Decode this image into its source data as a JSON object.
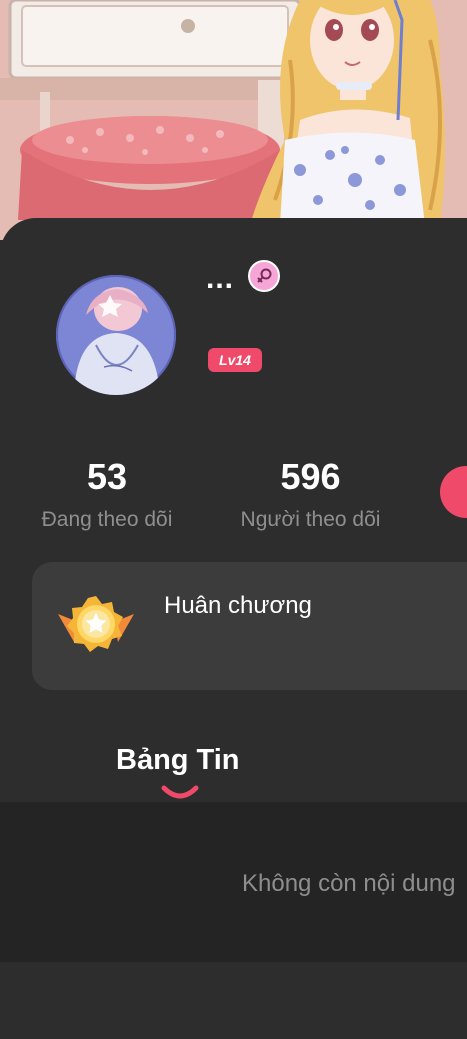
{
  "profile": {
    "username": "...",
    "gender_icon": "female-icon",
    "level": "Lv14",
    "avatar_icon": "avatar-photo"
  },
  "stats": {
    "following_count": "53",
    "following_label": "Đang theo dõi",
    "followers_count": "596",
    "followers_label": "Người theo dõi"
  },
  "medals": {
    "label": "Huân chương",
    "icon": "medal-icon"
  },
  "tabs": {
    "feed_label": "Bảng Tin"
  },
  "feed": {
    "empty_text": "Không còn nội dung"
  },
  "colors": {
    "accent": "#f04a6a",
    "background": "#2d2d2d",
    "card": "#3c3c3c",
    "feed_background": "#242424",
    "muted_text": "#8f8f8f",
    "gender_badge": "#f6a6d6"
  }
}
